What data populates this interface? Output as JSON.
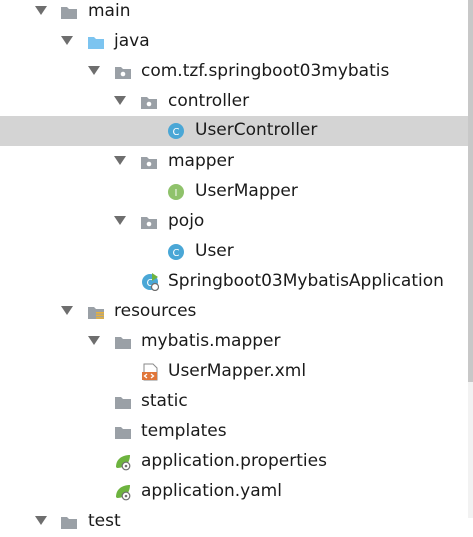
{
  "tree": {
    "main": "main",
    "java": "java",
    "package": "com.tzf.springboot03mybatis",
    "controller": "controller",
    "user_controller": "UserController",
    "mapper": "mapper",
    "user_mapper": "UserMapper",
    "pojo": "pojo",
    "user": "User",
    "application_class": "Springboot03MybatisApplication",
    "resources": "resources",
    "mybatis_mapper": "mybatis.mapper",
    "user_mapper_xml": "UserMapper.xml",
    "static": "static",
    "templates": "templates",
    "application_properties": "application.properties",
    "application_yaml": "application.yaml",
    "partial_next": "test"
  },
  "colors": {
    "selection": "#d4d4d4",
    "folder_gray": "#9aa0a6",
    "folder_blue": "#7cc4f0",
    "class_icon": "#4aa7d6",
    "interface_icon": "#8fc26b",
    "xml_icon": "#e0763a",
    "spring_leaf": "#6db33f"
  },
  "icons": {
    "folder": "folder-icon",
    "source_folder": "source-folder-icon",
    "package": "package-icon",
    "class": "class-icon",
    "interface": "interface-icon",
    "spring_app": "spring-boot-class-icon",
    "resources": "resources-folder-icon",
    "xml": "xml-file-icon",
    "spring_config": "spring-config-icon"
  }
}
